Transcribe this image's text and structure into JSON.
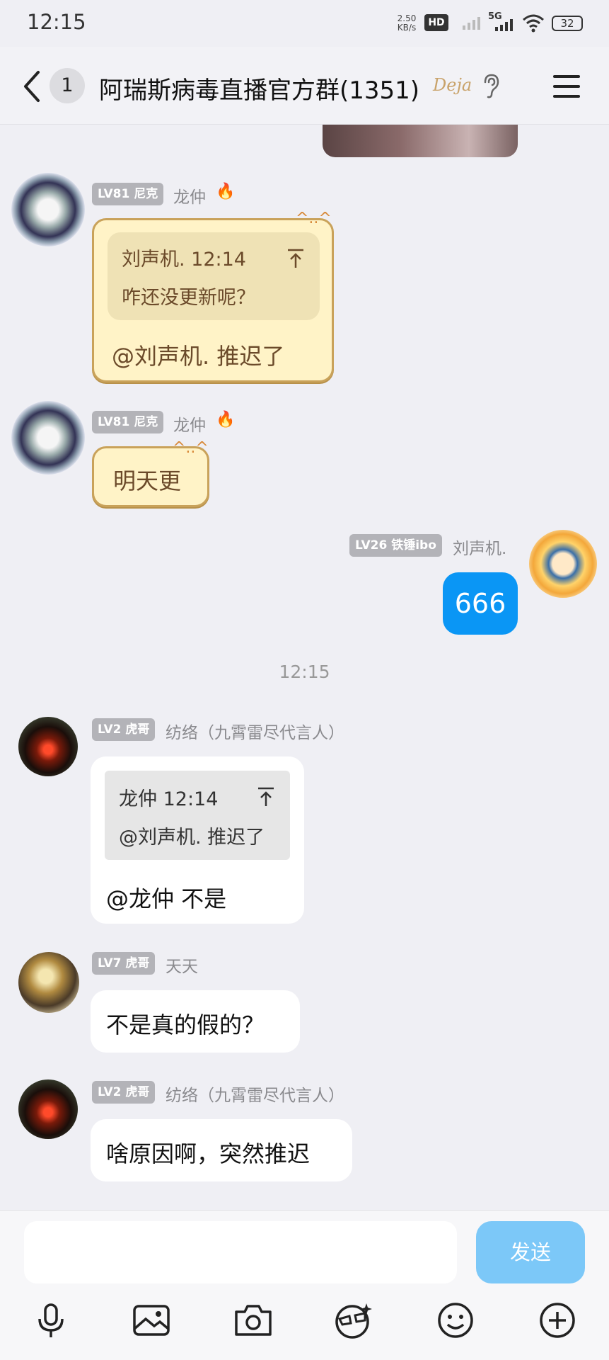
{
  "status_bar": {
    "time": "12:15",
    "net_speed": "2.50",
    "net_unit": "KB/s",
    "hd": "HD",
    "hd_sub": "2",
    "five_g": "5G",
    "battery": "32"
  },
  "header": {
    "back_icon": "chevron-left-icon",
    "unread_count": "1",
    "title": "阿瑞斯病毒直播官方群(1351)",
    "badge_text": "Deja",
    "menu_icon": "hamburger-icon"
  },
  "messages": [
    {
      "level": "LV81 尼克",
      "nick": "龙仲",
      "quote_header": "刘声机. 12:14",
      "quote_text": "咋还没更新呢？",
      "text": "@刘声机. 推迟了"
    },
    {
      "level": "LV81 尼克",
      "nick": "龙仲",
      "text": "明天更"
    },
    {
      "level": "LV26 铁锤ibo",
      "nick": "刘声机.",
      "text": "666"
    },
    {
      "level": "LV2 虎哥",
      "nick": "纺络（九霄雷尽代言人）",
      "quote_header": "龙仲 12:14",
      "quote_text": "@刘声机. 推迟了",
      "text": "@龙仲 不是"
    },
    {
      "level": "LV7 虎哥",
      "nick": "天天",
      "text": "不是真的假的？"
    },
    {
      "level": "LV2 虎哥",
      "nick": "纺络（九霄雷尽代言人）",
      "text": "啥原因啊，突然推迟"
    }
  ],
  "time_separator": "12:15",
  "input": {
    "placeholder": "",
    "send_label": "发送"
  },
  "toolbar": [
    "microphone-icon",
    "image-icon",
    "camera-icon",
    "ar-glasses-icon",
    "emoji-icon",
    "plus-icon"
  ],
  "colors": {
    "accent": "#0a96f5",
    "send_disabled": "#7cc8f8",
    "bubble_yellow": "#fff3c7"
  }
}
